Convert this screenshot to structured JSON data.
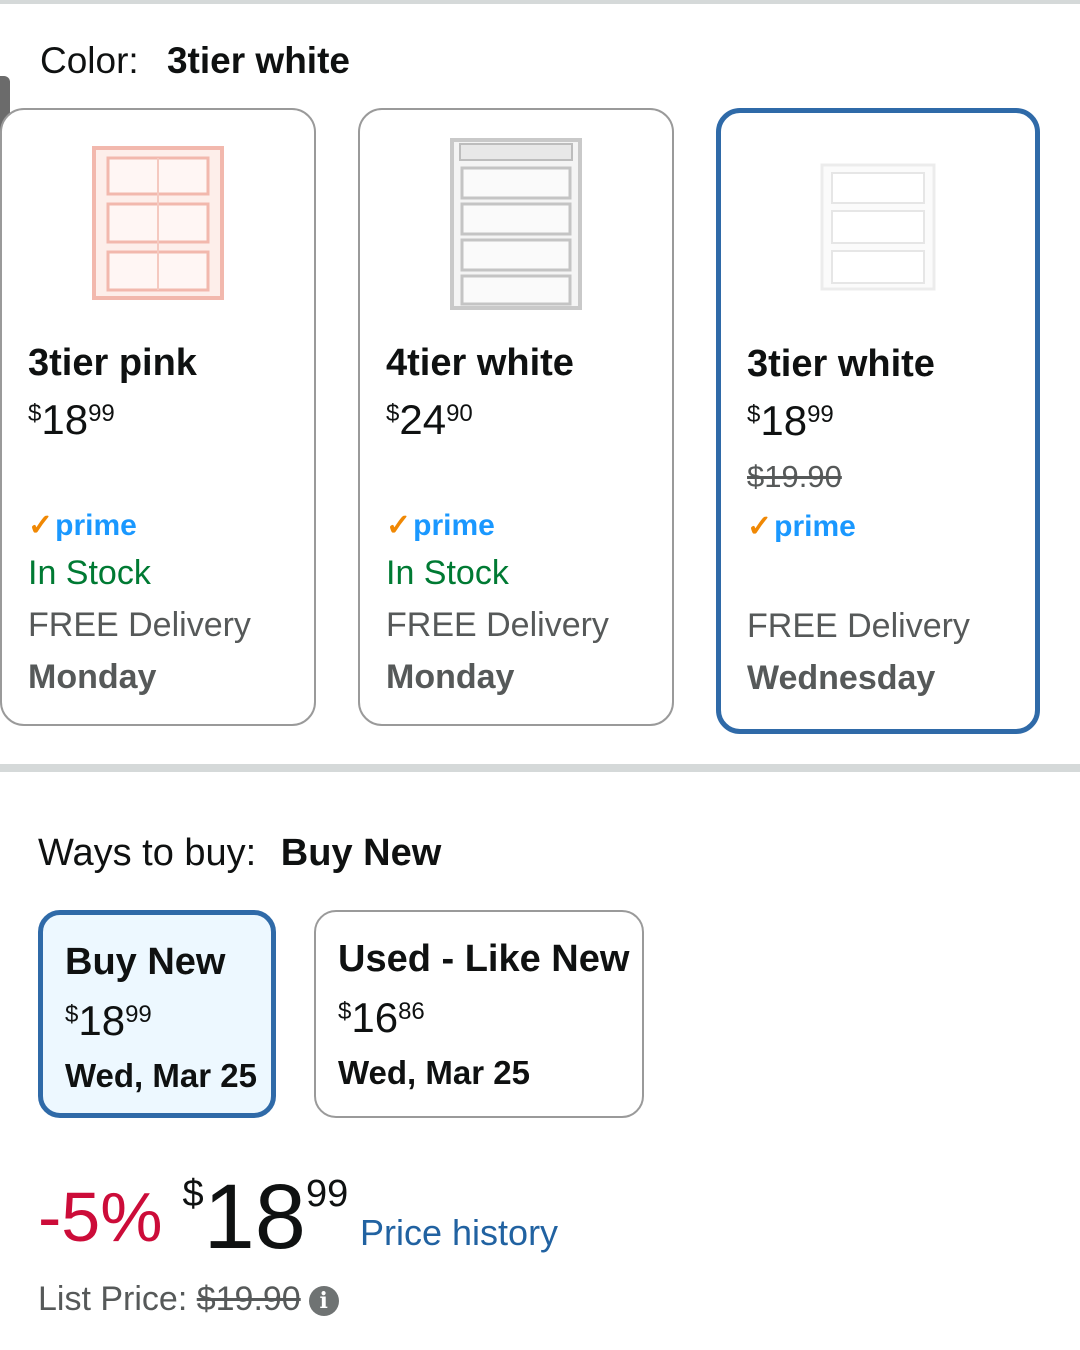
{
  "color_selector": {
    "label": "Color:",
    "selected_value": "3tier white",
    "options": [
      {
        "name": "3tier pink",
        "price_currency": "$",
        "price_whole": "18",
        "price_fraction": "99",
        "prime_label": "prime",
        "stock": "In Stock",
        "delivery": "FREE Delivery",
        "delivery_day": "Monday"
      },
      {
        "name": "4tier white",
        "price_currency": "$",
        "price_whole": "24",
        "price_fraction": "90",
        "prime_label": "prime",
        "stock": "In Stock",
        "delivery": "FREE Delivery",
        "delivery_day": "Monday"
      },
      {
        "name": "3tier white",
        "price_currency": "$",
        "price_whole": "18",
        "price_fraction": "99",
        "list_price": "$19.90",
        "prime_label": "prime",
        "delivery": "FREE Delivery",
        "delivery_day": "Wednesday",
        "selected": true
      }
    ]
  },
  "ways_to_buy": {
    "label": "Ways to buy:",
    "selected_value": "Buy New",
    "options": [
      {
        "name": "Buy New",
        "price_currency": "$",
        "price_whole": "18",
        "price_fraction": "99",
        "date": "Wed, Mar 25",
        "selected": true
      },
      {
        "name": "Used - Like New",
        "price_currency": "$",
        "price_whole": "16",
        "price_fraction": "86",
        "date": "Wed, Mar 25"
      }
    ]
  },
  "price_block": {
    "discount": "-5%",
    "currency": "$",
    "whole": "18",
    "fraction": "99",
    "history_link": "Price history",
    "list_price_label": "List Price:",
    "list_price_value": "$19.90",
    "info_icon_glyph": "i"
  },
  "colors": {
    "accent_blue": "#2f6aa8",
    "prime_blue": "#1a98ff",
    "in_stock_green": "#007a33",
    "discount_red": "#cc0c39",
    "link_blue": "#2162a1"
  }
}
